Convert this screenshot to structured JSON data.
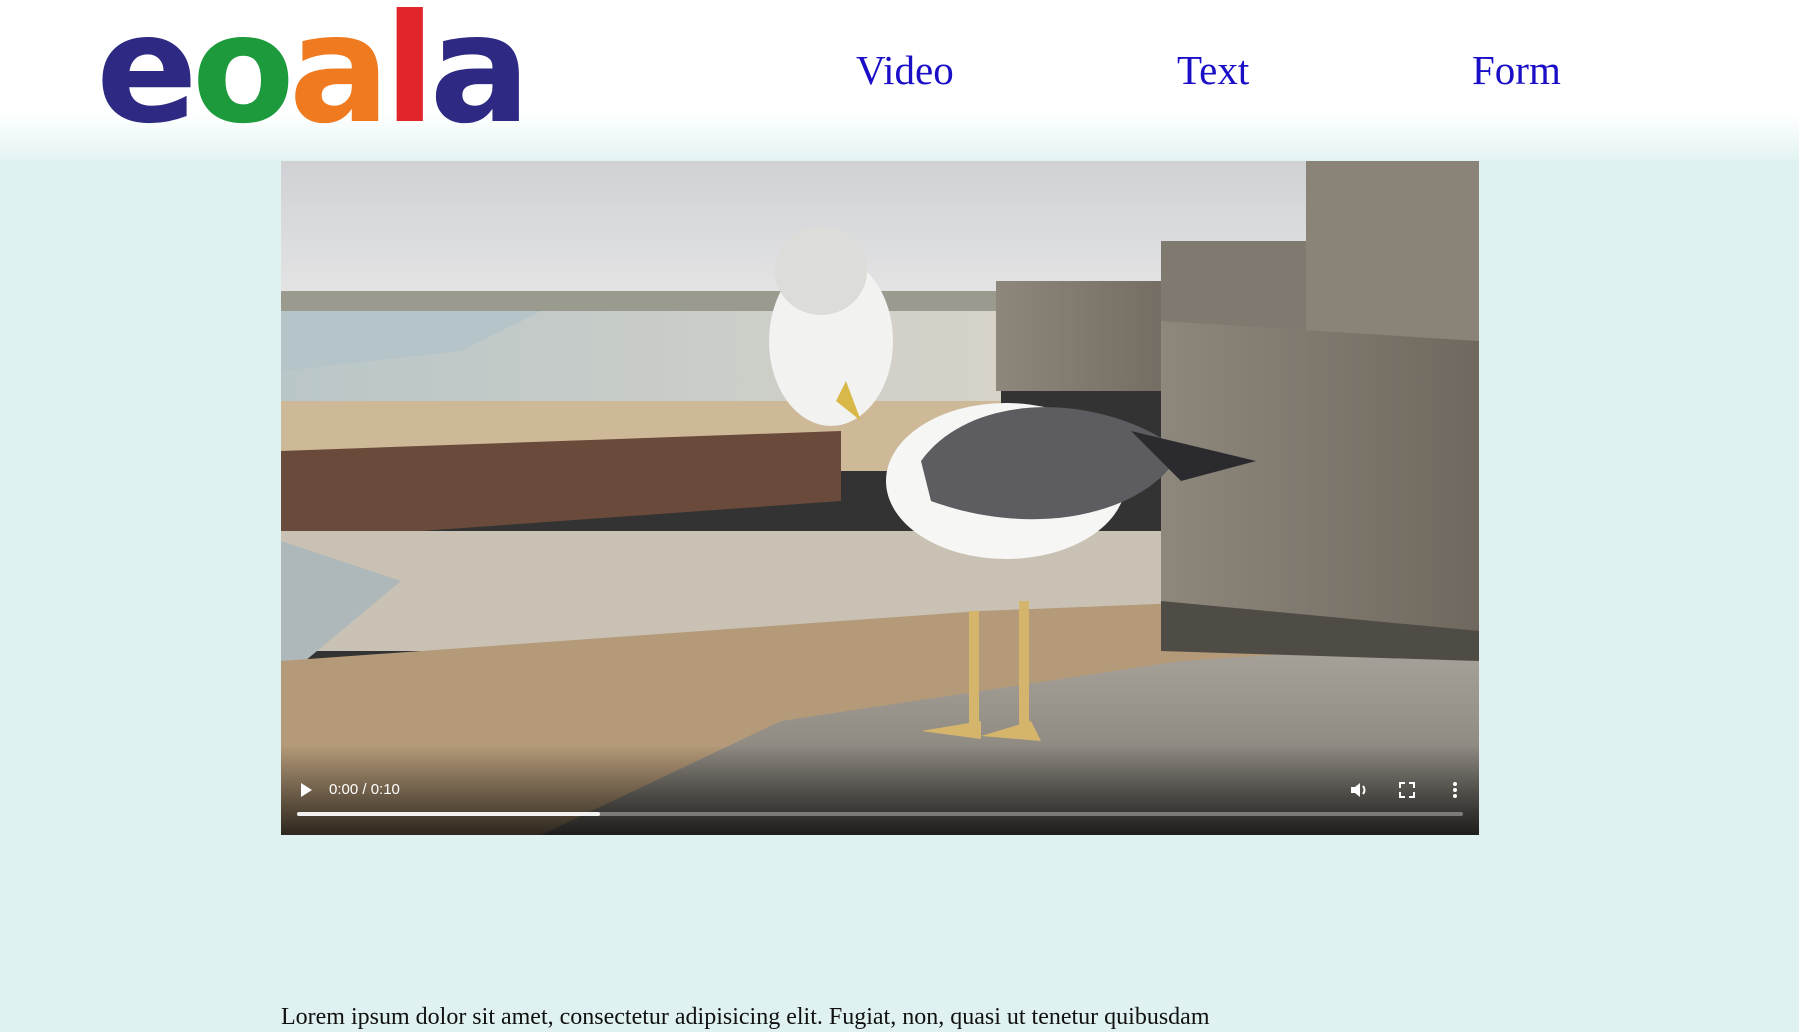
{
  "header": {
    "logo": {
      "letters": [
        {
          "char": "e",
          "color": "#2e2a83"
        },
        {
          "char": "o",
          "color": "#1c9a3c"
        },
        {
          "char": "a",
          "color": "#f07a1f"
        },
        {
          "char": "l",
          "color": "#e0262b"
        },
        {
          "char": "a",
          "color": "#2e2a83"
        }
      ]
    },
    "nav": [
      {
        "label": "Video"
      },
      {
        "label": "Text"
      },
      {
        "label": "Form"
      }
    ],
    "link_color": "#1a0fc7"
  },
  "video": {
    "time_display": "0:00 / 0:10",
    "progress_fraction": 0.26,
    "controls": [
      "play-icon",
      "volume-icon",
      "fullscreen-icon",
      "more-options-icon"
    ]
  },
  "main": {
    "text": "Lorem ipsum dolor sit amet, consectetur adipisicing elit. Fugiat, non, quasi ut tenetur quibusdam"
  },
  "colors": {
    "page_background": "#dff1f0",
    "header_background": "#ffffff"
  }
}
